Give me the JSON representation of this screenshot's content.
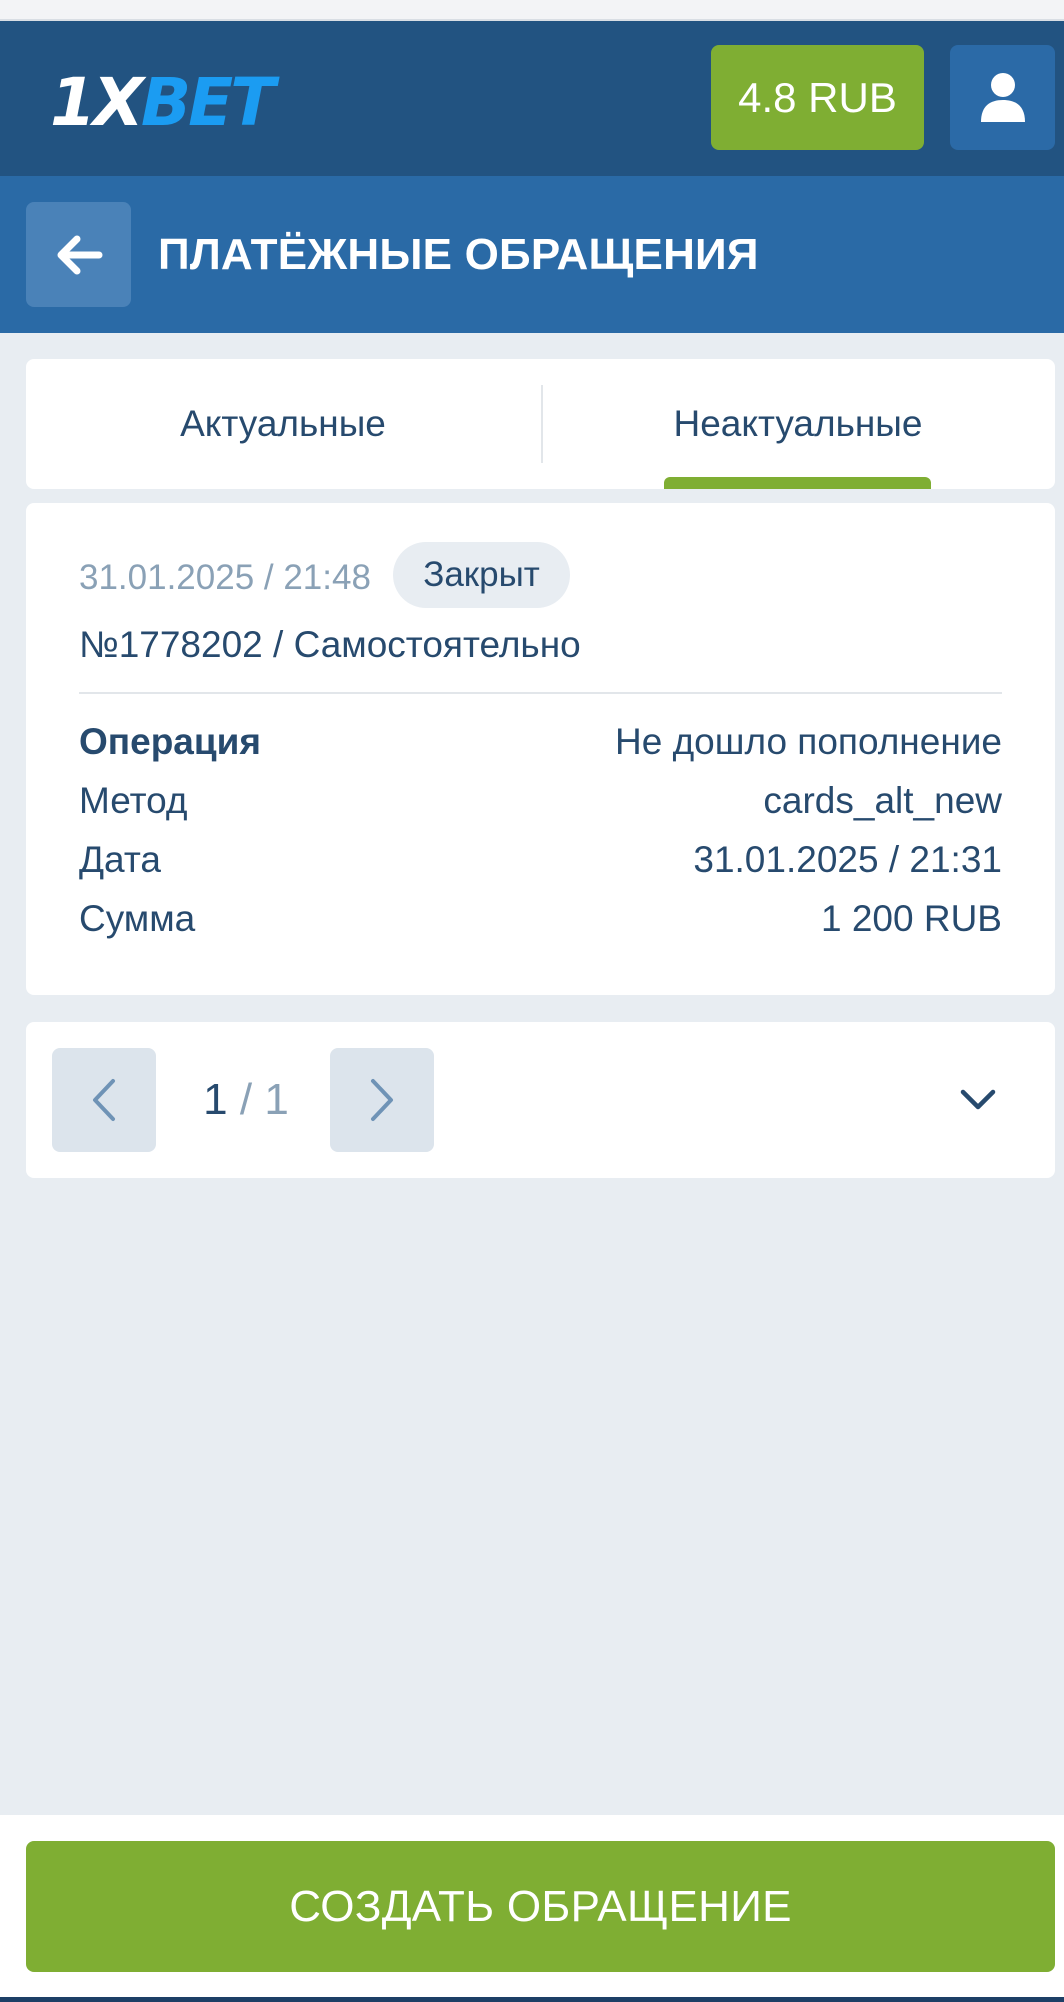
{
  "header": {
    "logo_prefix": "1X",
    "logo_suffix": "BET",
    "balance": "4.8 RUB",
    "icons": {
      "profile": "user-icon"
    }
  },
  "titlebar": {
    "title": "ПЛАТЁЖНЫЕ ОБРАЩЕНИЯ",
    "icons": {
      "back": "arrow-left-icon"
    }
  },
  "tabs": [
    {
      "label": "Актуальные",
      "active": false
    },
    {
      "label": "Неактуальные",
      "active": true
    }
  ],
  "ticket": {
    "created": "31.01.2025 / 21:48",
    "status": "Закрыт",
    "number_line": "№1778202 / Самостоятельно",
    "details": [
      {
        "key": "Операция",
        "value": "Не дошло пополнение"
      },
      {
        "key": "Метод",
        "value": "cards_alt_new"
      },
      {
        "key": "Дата",
        "value": "31.01.2025 / 21:31"
      },
      {
        "key": "Сумма",
        "value": "1 200 RUB"
      }
    ]
  },
  "pager": {
    "current": "1",
    "separator": "/",
    "total": "1",
    "icons": {
      "prev": "chevron-left-icon",
      "next": "chevron-right-icon",
      "dropdown": "chevron-down-icon"
    }
  },
  "actions": {
    "create_label": "СОЗДАТЬ ОБРАЩЕНИЕ"
  },
  "colors": {
    "header_bg": "#225381",
    "titlebar_bg": "#2a6aa6",
    "accent_green": "#7fae33",
    "logo_blue": "#1b9cf2",
    "text_primary": "#274a6e",
    "text_muted": "#8aa1b6",
    "page_bg": "#e8edf2"
  }
}
